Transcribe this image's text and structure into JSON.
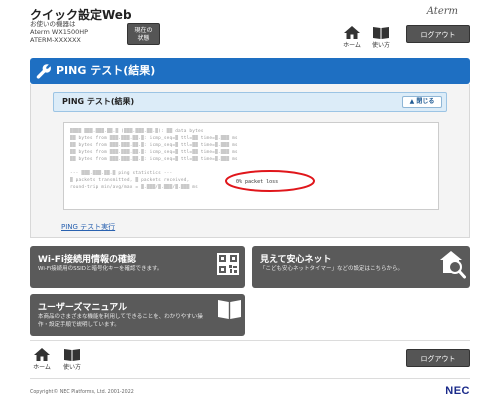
{
  "header": {
    "app_title": "クイック設定Web",
    "device_label": "お使いの機器は",
    "model": "Aterm WX1500HP",
    "device_id": "ATERM-XXXXXX",
    "status_button_line1": "現在の",
    "status_button_line2": "状態",
    "brand": "Aterm",
    "home_label": "ホーム",
    "manual_label": "使い方",
    "logout_label": "ログアウト"
  },
  "page": {
    "title": "PING テスト(結果)",
    "section_title": "PING テスト(結果)",
    "close_label": "閉じる",
    "loss_text": "0% packet loss",
    "ping_run_link": "PING テスト実行"
  },
  "tiles": [
    {
      "title": "Wi-Fi接続用情報の確認",
      "desc": "Wi-Fi接続用のSSIDと暗号化キーを確認できます。"
    },
    {
      "title": "見えて安心ネット",
      "desc": "「こども安心ネットタイマー」などの設定はこちらから。"
    },
    {
      "title": "ユーザーズマニュアル",
      "desc_line1": "本商品のさまざまな機能を利用してできることを、わかりやすい操",
      "desc_line2": "作・設定手順で説明しています。"
    }
  ],
  "footer": {
    "home_label": "ホーム",
    "manual_label": "使い方",
    "logout_label": "ログアウト",
    "copyright": "Copyright© NEC Platforms, Ltd. 2001-2022",
    "nec": "NEC"
  },
  "colors": {
    "accent": "#1e6fc2",
    "tile": "#5a5a5a",
    "highlight": "#e0161b"
  }
}
